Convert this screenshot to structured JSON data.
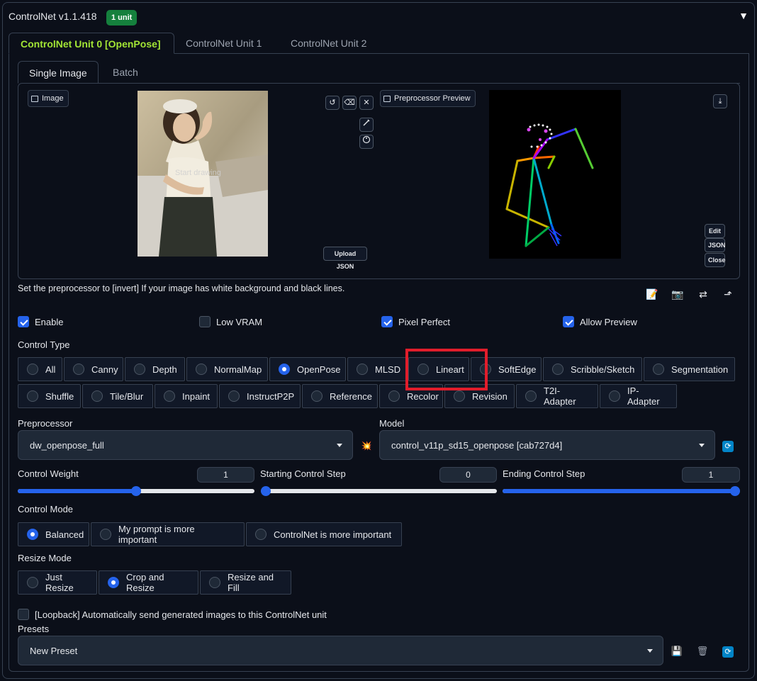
{
  "header": {
    "title": "ControlNet v1.1.418",
    "badge": "1 unit",
    "collapse_icon": "▼"
  },
  "unit_tabs": [
    "ControlNet Unit 0 [OpenPose]",
    "ControlNet Unit 1",
    "ControlNet Unit 2"
  ],
  "sub_tabs": [
    "Single Image",
    "Batch"
  ],
  "image_panel": {
    "label": "Image",
    "canvas_hint": "Start drawing",
    "tool_icons": [
      "↺",
      "⌫",
      "✕"
    ],
    "upload_json": "Upload JSON"
  },
  "preview_panel": {
    "label": "Preprocessor Preview",
    "download_icon": "⤓",
    "edit": "Edit",
    "json": "JSON",
    "close": "Close"
  },
  "hint": "Set the preprocessor to [invert] If your image has white background and black lines.",
  "checkboxes": {
    "enable": {
      "label": "Enable",
      "checked": true
    },
    "low_vram": {
      "label": "Low VRAM",
      "checked": false
    },
    "pixel_perfect": {
      "label": "Pixel Perfect",
      "checked": true
    },
    "allow_preview": {
      "label": "Allow Preview",
      "checked": true
    }
  },
  "control_type": {
    "label": "Control Type",
    "row1": [
      "All",
      "Canny",
      "Depth",
      "NormalMap",
      "OpenPose",
      "MLSD",
      "Lineart",
      "SoftEdge",
      "Scribble/Sketch",
      "Segmentation"
    ],
    "row2": [
      "Shuffle",
      "Tile/Blur",
      "Inpaint",
      "InstructP2P",
      "Reference",
      "Recolor",
      "Revision",
      "T2I-Adapter",
      "IP-Adapter"
    ],
    "selected": "OpenPose",
    "highlighted": "Lineart"
  },
  "preprocessor": {
    "label": "Preprocessor",
    "value": "dw_openpose_full",
    "run_icon": "💥"
  },
  "model": {
    "label": "Model",
    "value": "control_v11p_sd15_openpose [cab727d4]",
    "refresh_icon": "⟳"
  },
  "sliders": {
    "weight": {
      "label": "Control Weight",
      "value": "1",
      "fraction": 0.5
    },
    "start": {
      "label": "Starting Control Step",
      "value": "0",
      "fraction": 0.0
    },
    "end": {
      "label": "Ending Control Step",
      "value": "1",
      "fraction": 1.0
    }
  },
  "control_mode": {
    "label": "Control Mode",
    "options": [
      "Balanced",
      "My prompt is more important",
      "ControlNet is more important"
    ],
    "selected": "Balanced"
  },
  "resize_mode": {
    "label": "Resize Mode",
    "options": [
      "Just Resize",
      "Crop and Resize",
      "Resize and Fill"
    ],
    "selected": "Crop and Resize"
  },
  "loopback": {
    "label": "[Loopback] Automatically send generated images to this ControlNet unit",
    "checked": false
  },
  "presets": {
    "label": "Presets",
    "value": "New Preset",
    "save_icon": "💾",
    "delete_icon": "🗑",
    "refresh_icon": "⟳"
  },
  "colors": {
    "accent": "#2563eb",
    "badge": "#15803d",
    "active_tab": "#a3e635",
    "highlight": "#e11d2b"
  }
}
